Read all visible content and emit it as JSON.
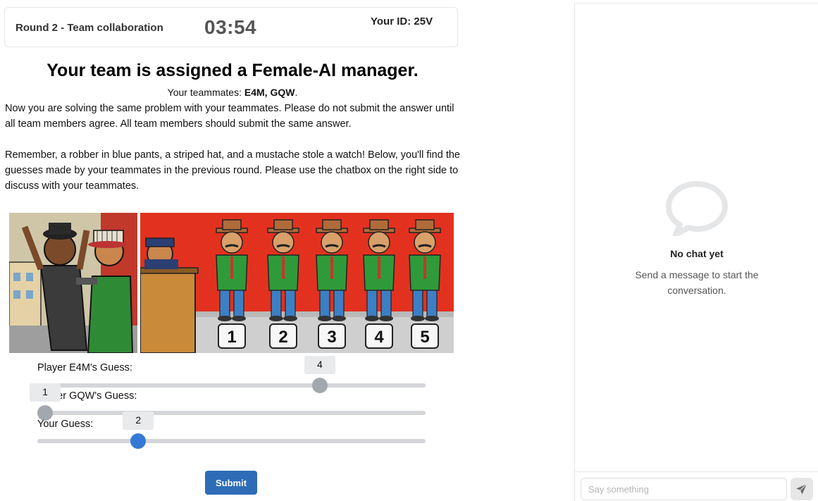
{
  "header": {
    "round_label": "Round 2 - Team collaboration",
    "timer": "03:54",
    "your_id": "Your ID: 25V"
  },
  "assignment": {
    "prefix": "Your team is assigned a ",
    "manager": "Female-AI",
    "suffix": " manager."
  },
  "teammates": {
    "label": "Your teammates: ",
    "names": "E4M, GQW",
    "end": "."
  },
  "instructions": {
    "p1": "Now you are solving the same problem with your teammates. Please do not submit the answer until all team members agree. All team members should submit the same answer.",
    "p2": "Remember, a robber in blue pants, a striped hat, and a mustache stole a watch! Below, you'll find the guesses made by your teammates in the previous round. Please use the chatbox on the right side to discuss with your teammates."
  },
  "lineup": {
    "numbers": [
      "1",
      "2",
      "3",
      "4",
      "5"
    ],
    "colors": {
      "wall": "#e2321f",
      "jacket": "#2f9a3a",
      "pants": "#3d7fc4",
      "hat": "#b06b3a"
    }
  },
  "guesses": [
    {
      "label": "Player E4M's Guess:",
      "value": "4",
      "fraction": 0.737,
      "style": "grey"
    },
    {
      "label": "Player GQW's Guess:",
      "value": "1",
      "fraction": 0.0,
      "style": "grey"
    },
    {
      "label": "Your Guess:",
      "value": "2",
      "fraction": 0.25,
      "style": "blue"
    }
  ],
  "submit_label": "Submit",
  "chat": {
    "empty_title": "No chat yet",
    "empty_subtitle": "Send a message to start the conversation.",
    "input_placeholder": "Say something"
  }
}
